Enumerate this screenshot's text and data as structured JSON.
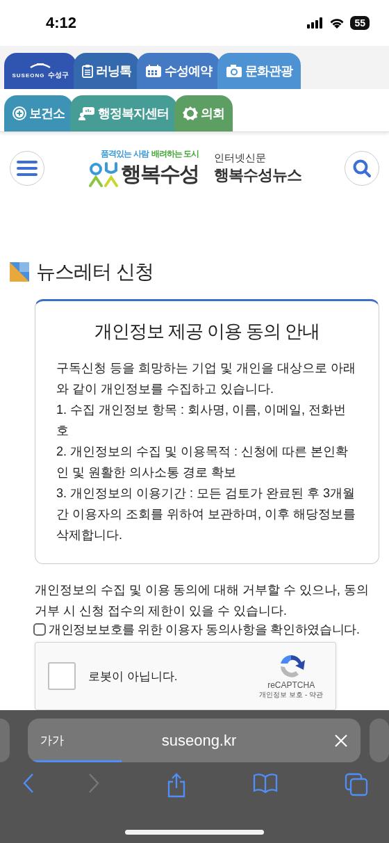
{
  "status_bar": {
    "time": "4:12",
    "battery": "55"
  },
  "site_tabs": [
    [
      {
        "kind": "logo",
        "label": "SUSEONG",
        "sublabel": "수성구",
        "color": "#2f55b0"
      },
      {
        "kind": "label",
        "label": "러닝톡",
        "color": "#3469ad"
      },
      {
        "kind": "label",
        "label": "수성예약",
        "color": "#4479c4"
      },
      {
        "kind": "label",
        "label": "문화관광",
        "color": "#4d92d3"
      }
    ],
    [
      {
        "kind": "label",
        "label": "보건소",
        "color": "#3c93b5"
      },
      {
        "kind": "label",
        "label": "행정복지센터",
        "color": "#469d95"
      },
      {
        "kind": "label",
        "label": "의회",
        "color": "#5d9e62"
      }
    ]
  ],
  "header": {
    "slogan_left": "품격있는 사람",
    "slogan_right": "배려하는 도시",
    "logo_text": "행복수성",
    "newspaper_caption": "인터넷신문",
    "newspaper_name": "행복수성뉴스"
  },
  "page_title": "뉴스레터 신청",
  "notice": {
    "title": "개인정보 제공 이용 동의 안내",
    "lines": [
      "구독신청 등을 희망하는 기업 및 개인을 대상으로 아래와 같이 개인정보를 수집하고 있습니다.",
      "1. 수집 개인정보 항목 : 회사명, 이름, 이메일, 전화번호",
      "2. 개인정보의 수집 및 이용목적 : 신청에 따른 본인확인 및 원활한 의사소통 경로 확보",
      "3. 개인정보의 이용기간 : 모든 검토가 완료된 후 3개월간 이용자의 조회를 위하여 보관하며, 이후 해당정보를 삭제합니다."
    ]
  },
  "consent_text": "개인정보의 수집 및 이용 동의에 대해 거부할 수 있으나, 동의 거부 시 신청 접수의 제한이 있을 수 있습니다.",
  "consent_checkbox": {
    "label": "개인정보보호를 위한 이용자 동의사항을 확인하였습니다.",
    "checked": false
  },
  "captcha": {
    "label": "로봇이 아닙니다.",
    "checked": false,
    "brand": "reCAPTCHA",
    "links": "개인정보 보호 - 약관"
  },
  "browser": {
    "text_size": "가가",
    "url": "suseong.kr",
    "level": 0.27,
    "back_disabled": false,
    "forward_disabled": true
  }
}
